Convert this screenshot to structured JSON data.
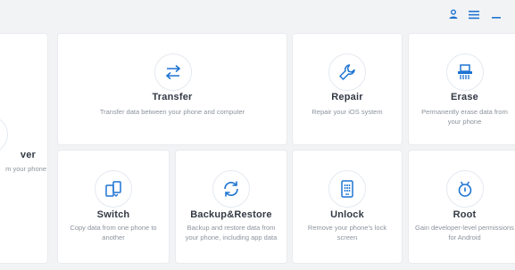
{
  "header": {
    "account_icon": "user-icon",
    "menu_icon": "hamburger-menu-icon",
    "minimize_icon": "minimize-icon"
  },
  "colors": {
    "accent": "#1e74d2",
    "background": "#f2f3f5",
    "card": "#ffffff",
    "title": "#333a44",
    "desc": "#8c939d"
  },
  "tools": {
    "recover": {
      "title": "ver",
      "desc": "m your phone",
      "icon": "recover-icon"
    },
    "transfer": {
      "title": "Transfer",
      "desc": "Transfer data between your phone and computer",
      "icon": "transfer-arrows-icon"
    },
    "repair": {
      "title": "Repair",
      "desc": "Repair your iOS system",
      "icon": "wrench-icon"
    },
    "erase": {
      "title": "Erase",
      "desc": "Permanently erase data from your phone",
      "icon": "shredder-icon"
    },
    "switch": {
      "title": "Switch",
      "desc": "Copy data from one phone to another",
      "icon": "phones-switch-icon"
    },
    "backup": {
      "title": "Backup&Restore",
      "desc": "Backup and restore data from your phone, including app data",
      "icon": "sync-icon"
    },
    "unlock": {
      "title": "Unlock",
      "desc": "Remove your phone's lock screen",
      "icon": "phone-keypad-icon"
    },
    "root": {
      "title": "Root",
      "desc": "Gain developer-level permissions for Android",
      "icon": "root-icon"
    }
  }
}
